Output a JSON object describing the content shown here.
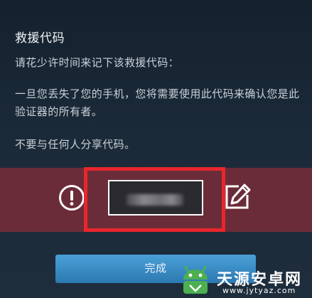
{
  "dialog": {
    "title": "救援代码",
    "line1": "请花少许时间来记下该救援代码：",
    "line2": "一旦您丢失了您的手机，您将需要使用此代码来确认您是此验证器的所有者。",
    "line3": "不要与任何人分享代码。"
  },
  "code_panel": {
    "code_value": "R3",
    "warn_icon": "exclamation-circle-icon",
    "edit_icon": "edit-pencil-icon",
    "band_color": "#6b2c39",
    "highlight_color": "#e8262c"
  },
  "actions": {
    "done_label": "完成"
  },
  "watermark": {
    "name": "天源安卓网",
    "url": "www.jytyaz.com"
  }
}
